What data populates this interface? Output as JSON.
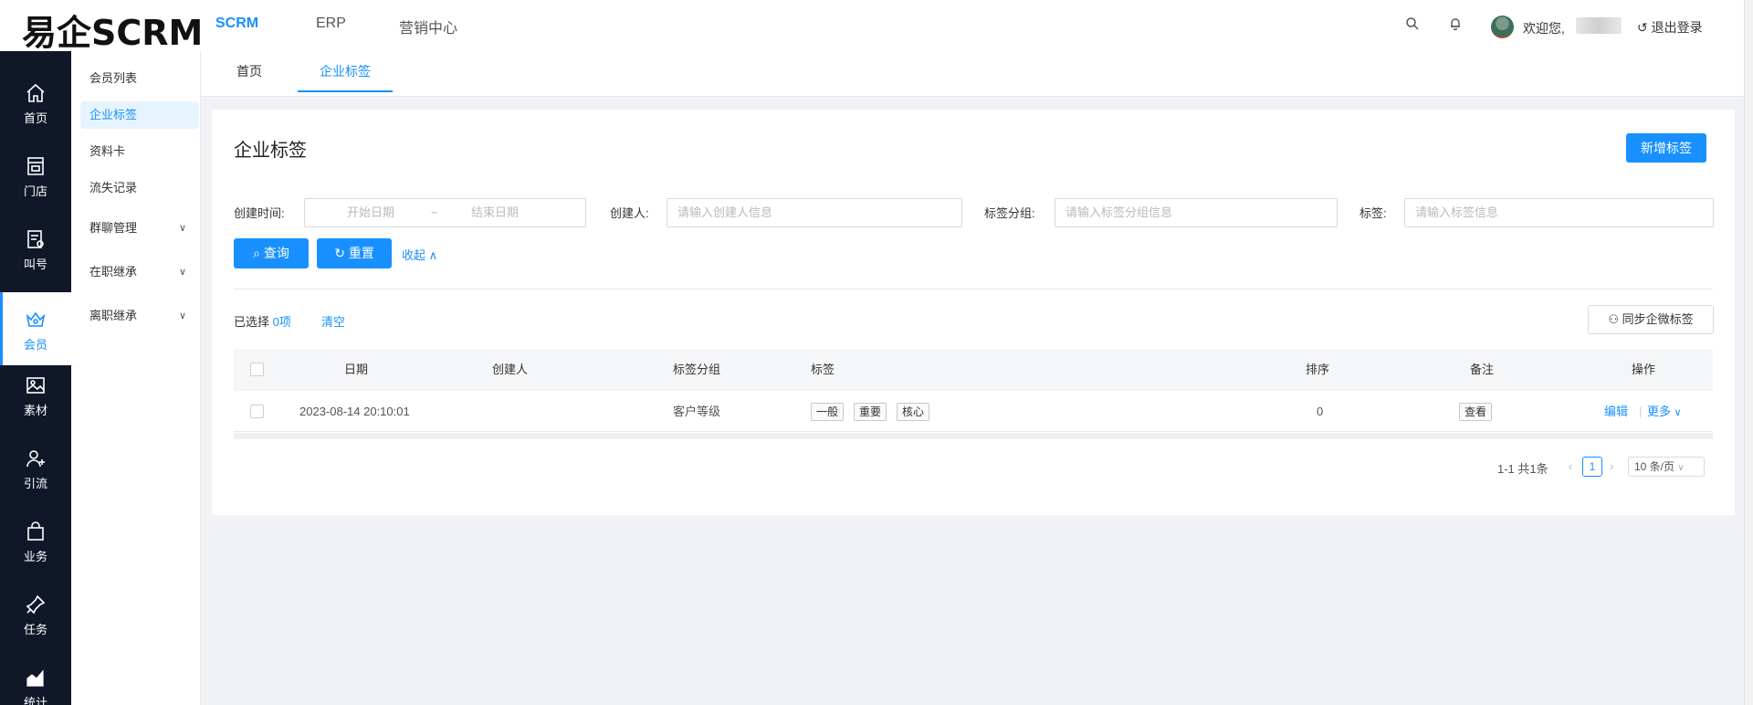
{
  "app": {
    "logo": "易企SCRM",
    "nav": [
      "SCRM",
      "ERP",
      "营销中心"
    ],
    "active_nav": "SCRM",
    "welcome": "欢迎您,",
    "logout": "退出登录"
  },
  "rail": [
    {
      "label": "首页",
      "icon": "home-icon"
    },
    {
      "label": "门店",
      "icon": "store-icon"
    },
    {
      "label": "叫号",
      "icon": "queue-icon"
    },
    {
      "label": "会员",
      "icon": "member-crown-icon",
      "active": true
    },
    {
      "label": "素材",
      "icon": "image-icon"
    },
    {
      "label": "引流",
      "icon": "user-add-icon"
    },
    {
      "label": "业务",
      "icon": "bag-icon"
    },
    {
      "label": "任务",
      "icon": "pin-icon"
    },
    {
      "label": "统计",
      "icon": "chart-icon"
    }
  ],
  "submenu": [
    {
      "label": "会员列表"
    },
    {
      "label": "企业标签",
      "active": true
    },
    {
      "label": "资料卡"
    },
    {
      "label": "流失记录"
    },
    {
      "label": "群聊管理",
      "expandable": true
    },
    {
      "label": "在职继承",
      "expandable": true
    },
    {
      "label": "离职继承",
      "expandable": true
    }
  ],
  "tabs": [
    "首页",
    "企业标签"
  ],
  "page": {
    "title": "企业标签",
    "new_button": "新增标签"
  },
  "filters": {
    "created_time_label": "创建时间:",
    "start_placeholder": "开始日期",
    "range_sep": "~",
    "end_placeholder": "结束日期",
    "creator_label": "创建人:",
    "creator_placeholder": "请输入创建人信息",
    "group_label": "标签分组:",
    "group_placeholder": "请输入标签分组信息",
    "tag_label": "标签:",
    "tag_placeholder": "请输入标签信息",
    "query_button": "查询",
    "reset_button": "重置",
    "collapse_link": "收起"
  },
  "selection": {
    "prefix": "已选择",
    "count": "0项",
    "clear": "清空",
    "sync_button": "同步企微标签"
  },
  "table": {
    "columns": [
      "日期",
      "创建人",
      "标签分组",
      "标签",
      "排序",
      "备注",
      "操作"
    ],
    "rows": [
      {
        "date": "2023-08-14 20:10:01",
        "creator": "",
        "group": "客户等级",
        "tags": [
          "一般",
          "重要",
          "核心"
        ],
        "sort": "0",
        "remark": "查看",
        "edit": "编辑",
        "more": "更多"
      }
    ]
  },
  "pagination": {
    "total": "1-1 共1条",
    "current": "1",
    "page_size": "10 条/页"
  },
  "colors": {
    "primary": "#1890ff",
    "rail_bg": "#0f1729"
  }
}
